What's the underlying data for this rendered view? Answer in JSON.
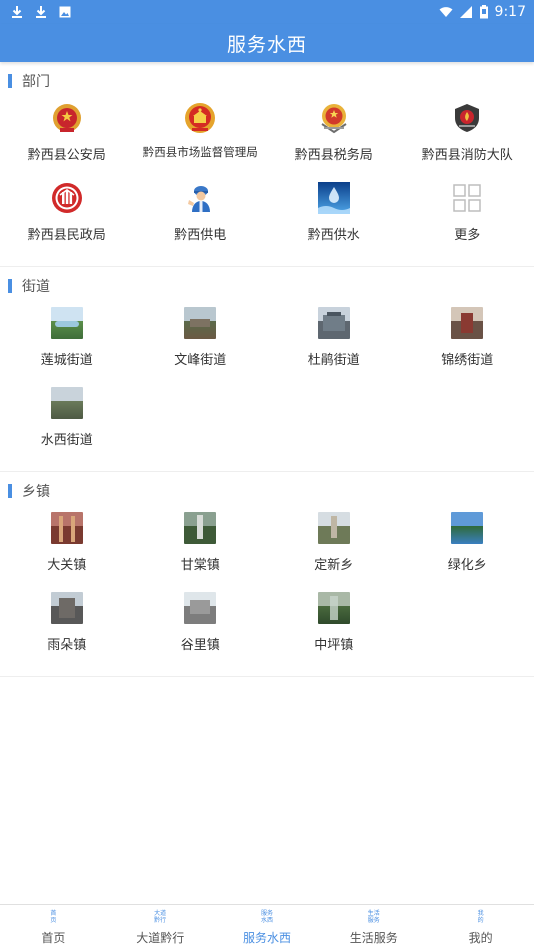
{
  "status_bar": {
    "time": "9:17"
  },
  "title": "服务水西",
  "sections": {
    "departments": {
      "title": "部门",
      "items": [
        {
          "label": "黔西县公安局",
          "icon": "police-emblem-icon"
        },
        {
          "label": "黔西县市场监督管理局",
          "icon": "national-emblem-icon"
        },
        {
          "label": "黔西县税务局",
          "icon": "tax-emblem-icon"
        },
        {
          "label": "黔西县消防大队",
          "icon": "fire-emblem-icon"
        },
        {
          "label": "黔西县民政局",
          "icon": "civil-affairs-emblem-icon"
        },
        {
          "label": "黔西供电",
          "icon": "power-worker-icon"
        },
        {
          "label": "黔西供水",
          "icon": "water-icon"
        },
        {
          "label": "更多",
          "icon": "grid-icon"
        }
      ]
    },
    "streets": {
      "title": "街道",
      "items": [
        {
          "label": "莲城街道"
        },
        {
          "label": "文峰街道"
        },
        {
          "label": "杜鹃街道"
        },
        {
          "label": "锦绣街道"
        },
        {
          "label": "水西街道"
        }
      ]
    },
    "towns": {
      "title": "乡镇",
      "items": [
        {
          "label": "大关镇"
        },
        {
          "label": "甘棠镇"
        },
        {
          "label": "定新乡"
        },
        {
          "label": "绿化乡"
        },
        {
          "label": "雨朵镇"
        },
        {
          "label": "谷里镇"
        },
        {
          "label": "中坪镇"
        }
      ]
    }
  },
  "bottom_nav": [
    {
      "label": "首页",
      "icon_text": [
        "首",
        "页"
      ]
    },
    {
      "label": "大道黔行",
      "icon_text": [
        "大道",
        "黔行"
      ]
    },
    {
      "label": "服务水西",
      "icon_text": [
        "服务",
        "水西"
      ]
    },
    {
      "label": "生活服务",
      "icon_text": [
        "生活",
        "服务"
      ]
    },
    {
      "label": "我的",
      "icon_text": [
        "我",
        "的"
      ]
    }
  ],
  "colors": {
    "accent": "#4a8fe2"
  }
}
